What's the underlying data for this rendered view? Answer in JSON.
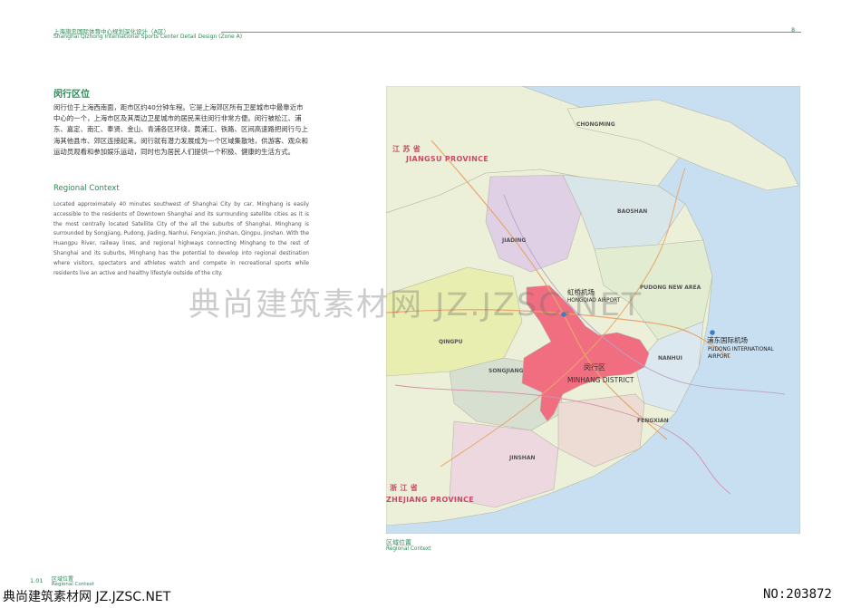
{
  "header": {
    "title_cn": "上海旗忠国际体育中心规划深化设计（A区）",
    "title_en": "Shanghai Qizhong International Sports Center Detail Design (Zone A)",
    "page_number": "8"
  },
  "section_cn": {
    "title": "闵行区位",
    "body": "闵行位于上海西南面，距市区约40分钟车程。它是上海郊区所有卫星城市中最靠近市中心的一个，上海市区及其周边卫星城市的居民来往闵行非常方便。闵行被松江、浦东、嘉定、南汇、奉贤、金山、青浦各区环绕，黄浦江、铁路、区间高速路把闵行与上海其他县市、郊区连接起来。闵行就有潜力发展成为一个区域集散地，供游客、观众和运动员观看和参加娱乐运动，同时也为居民人们提供一个积极、健康的生活方式。"
  },
  "section_en": {
    "title": "Regional Context",
    "body": "Located approximately 40 minutes southwest of Shanghai City by car, Minghang is easily accessible to the residents of Downtown Shanghai and its surrounding satellite cities as it is the most centrally located Satellite City of the all the suburbs of Shanghai. Minghang is surrounded by Songjiang, Pudong, Jiading, Nanhui, Fengxian, Jinshan, Qingpu, Jinshan. With the Huangpu River, railway lines, and regional highways connecting Minghang to the rest of Shanghai and its suburbs, Minghang has the potential to develop into regional destination where visitors, spectators and athletes watch and compete in recreational sports while residents live an active and healthy lifestyle outside of the city."
  },
  "map": {
    "provinces": {
      "jiangsu_cn": "江 苏 省",
      "jiangsu_en": "JIANGSU PROVINCE",
      "zhejiang_cn": "浙 江 省",
      "zhejiang_en": "ZHEJIANG PROVINCE"
    },
    "districts": {
      "baoshan": "BAOSHAN",
      "jiading": "JIADING",
      "qingpu": "QINGPU",
      "songjiang": "SONGJIANG",
      "jinshan": "JINSHAN",
      "fengxian": "FENGXIAN",
      "nanhui": "NANHUI",
      "chongming": "CHONGMING",
      "pudong_new_area": "PUDONG NEW AREA"
    },
    "hongqiao_cn": "虹桥机场",
    "hongqiao_en": "HONGQIAO AIRPORT",
    "pudong_cn": "浦东国际机场",
    "pudong_en_1": "PUDONG INTERNATIONAL",
    "pudong_en_2": "AIRPORT",
    "minhang_cn": "闵行区",
    "minhang_en": "MINHANG DISTRICT",
    "colors": {
      "water": "#c7dff0",
      "land": "#ecf0d8",
      "minhang": "#f06e80",
      "jiading": "#dfd0e6",
      "qingpu": "#e8edb0",
      "songjiang": "#d6dfd0",
      "jinshan": "#ecd8de",
      "fengxian": "#ecdcd4",
      "nanhui": "#dce8f0",
      "baoshan": "#d8e6ea",
      "pudong": "#e2ecd0"
    }
  },
  "caption": {
    "cn": "区域位置",
    "en": "Regional Context"
  },
  "footer": {
    "num": "1.01",
    "cn": "区域位置",
    "en": "Regional Context"
  },
  "watermarks": {
    "center": "典尚建筑素材网 JZ.JZSC.NET",
    "bottom": "典尚建筑素材网 JZ.JZSC.NET",
    "number": "NO:203872"
  }
}
